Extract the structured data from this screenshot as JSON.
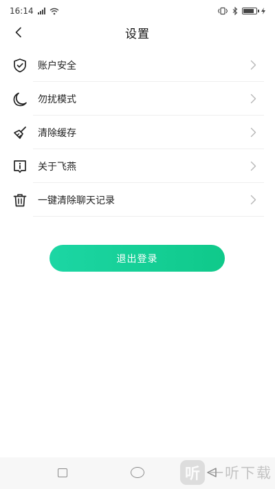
{
  "status_bar": {
    "time": "16:14",
    "battery_level": 0.85
  },
  "header": {
    "title": "设置"
  },
  "settings": {
    "items": [
      {
        "label": "账户安全",
        "icon": "shield-check-icon"
      },
      {
        "label": "勿扰模式",
        "icon": "moon-icon"
      },
      {
        "label": "清除缓存",
        "icon": "broom-icon"
      },
      {
        "label": "关于飞燕",
        "icon": "info-icon"
      },
      {
        "label": "一键清除聊天记录",
        "icon": "trash-icon"
      }
    ]
  },
  "logout": {
    "label": "退出登录",
    "gradient_start": "#1cd6a4",
    "gradient_end": "#0fc98a"
  },
  "colors": {
    "icon": "#222222",
    "chevron": "#b5b5b5"
  },
  "watermark": {
    "logo_glyph": "听",
    "text": "一听下载"
  }
}
